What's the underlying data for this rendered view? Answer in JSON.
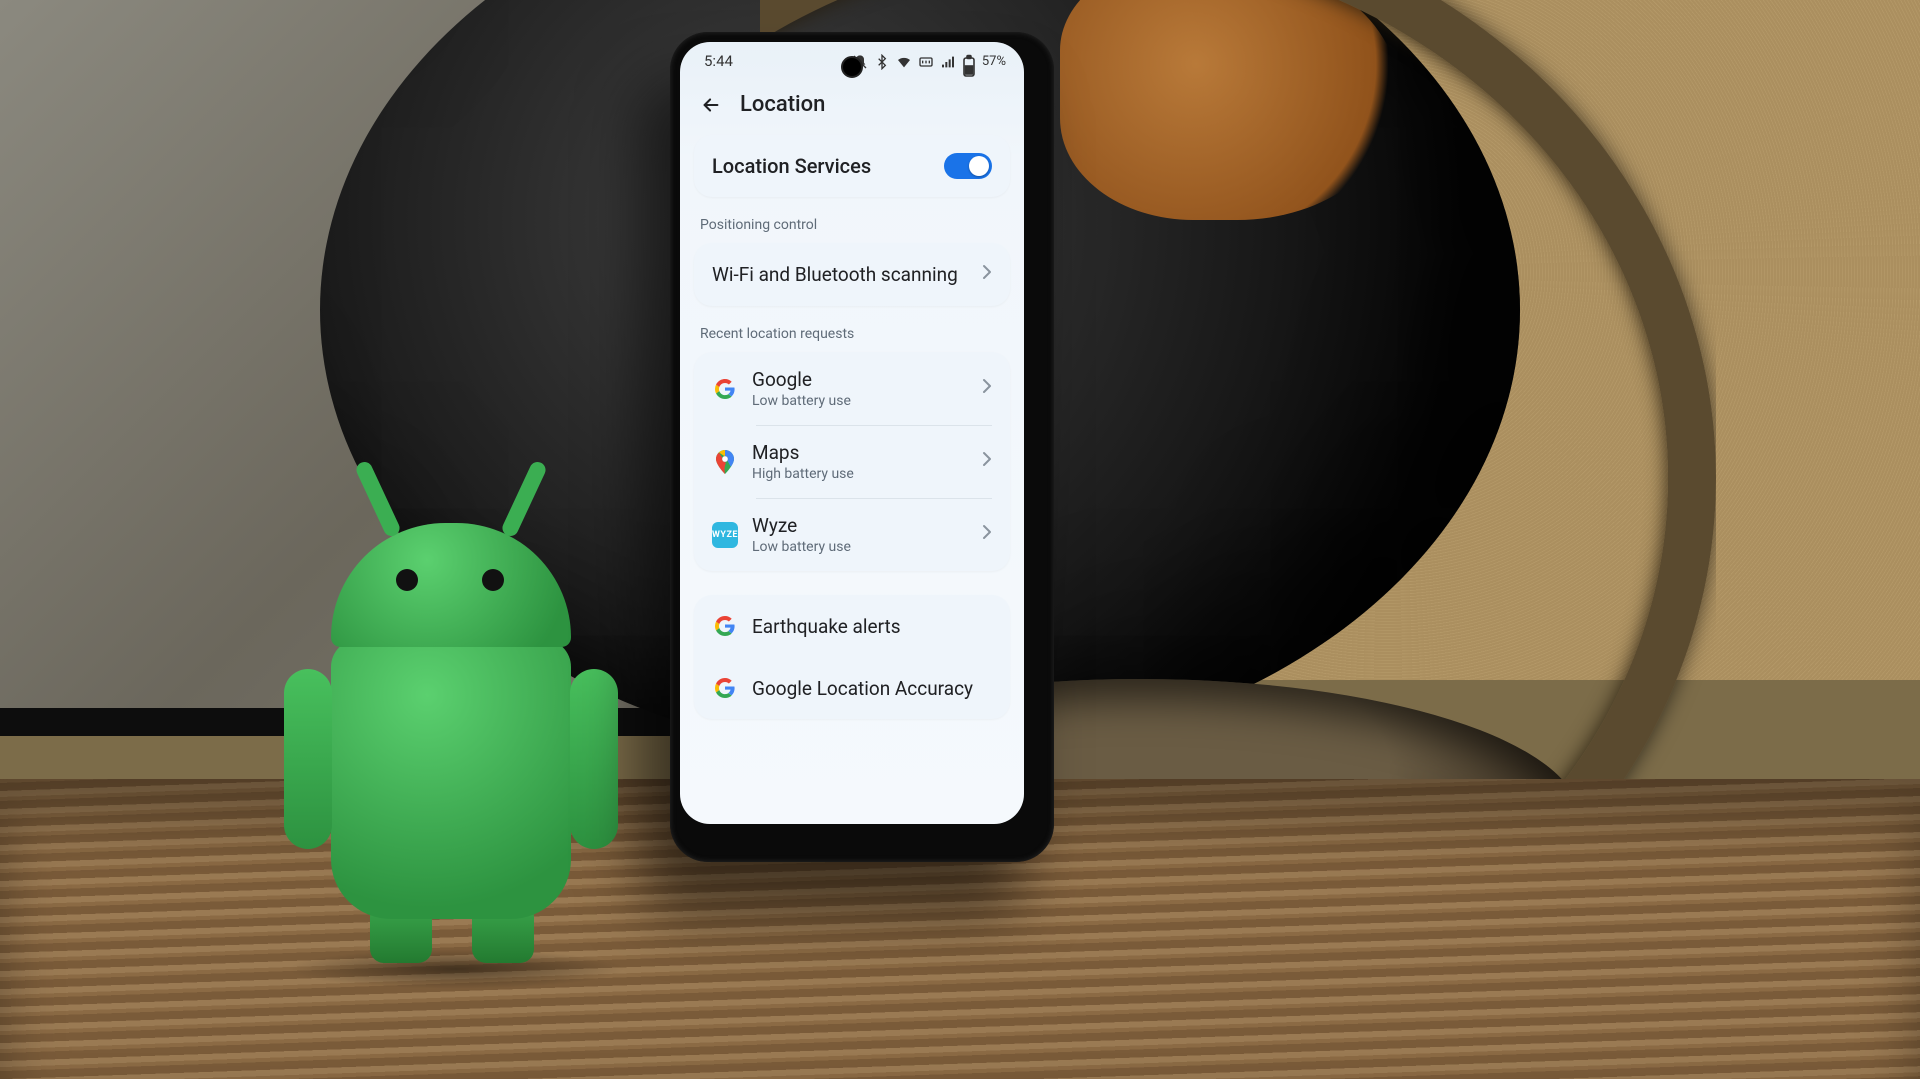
{
  "status": {
    "time": "5:44",
    "battery_text": "57%"
  },
  "header": {
    "title": "Location"
  },
  "master_toggle": {
    "label": "Location Services",
    "on": true
  },
  "sections": {
    "positioning_label": "Positioning control",
    "recent_label": "Recent location requests"
  },
  "positioning": {
    "wifi_bt_label": "Wi-Fi and Bluetooth scanning"
  },
  "recent_apps": [
    {
      "icon": "google",
      "name": "Google",
      "sub": "Low battery use"
    },
    {
      "icon": "maps",
      "name": "Maps",
      "sub": "High battery use"
    },
    {
      "icon": "wyze",
      "name": "Wyze",
      "sub": "Low battery use"
    }
  ],
  "services": [
    {
      "icon": "google",
      "label": "Earthquake alerts"
    },
    {
      "icon": "google",
      "label": "Google Location Accuracy"
    }
  ],
  "icons": {
    "wyze_text": "WYZE"
  }
}
